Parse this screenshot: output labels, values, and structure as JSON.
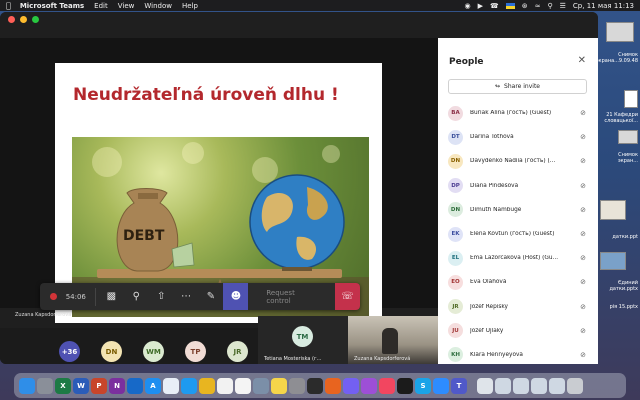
{
  "menubar": {
    "app_name": "Microsoft Teams",
    "menus": [
      "Edit",
      "View",
      "Window",
      "Help"
    ],
    "clock": "Ср, 11 мая  11:13"
  },
  "slide": {
    "title": "Neudržateľná úroveň dlhu !",
    "bag_label": "DEBT"
  },
  "toolbar": {
    "timer": "54:06",
    "request_control": "Request control"
  },
  "presenter_name": "Zuzana Kapsdorferová",
  "strip": {
    "overflow_count": "+36",
    "avatars": [
      {
        "initials": "DN",
        "color": "#f3e4b3",
        "text": "#7a5c00"
      },
      {
        "initials": "WM",
        "color": "#dbead0",
        "text": "#3f6b28"
      },
      {
        "initials": "TP",
        "color": "#f1dcd5",
        "text": "#7a3e2b"
      },
      {
        "initials": "JR",
        "color": "#dde7cf",
        "text": "#4b6a2a"
      }
    ],
    "tile_tm": {
      "initials": "TM",
      "name": "Tetiana Mosteriska (г..."
    },
    "tile_zk": {
      "name": "Zuzana Kapsdorferová"
    }
  },
  "people": {
    "title": "People",
    "share_label": "Share invite",
    "participants": [
      {
        "initials": "BA",
        "name": "Buriak Alina (гость) (Guest)",
        "color": "#f1dbe0",
        "text": "#8a2d45"
      },
      {
        "initials": "DT",
        "name": "Darina Tóthová",
        "color": "#dde3f5",
        "text": "#3a4f9a"
      },
      {
        "initials": "DN",
        "name": "Davydenko Nadiia (гость) (...",
        "color": "#f8e7bf",
        "text": "#8a6100"
      },
      {
        "initials": "DP",
        "name": "Diana Pindešová",
        "color": "#e2ddf3",
        "text": "#4b3c91"
      },
      {
        "initials": "DN",
        "name": "Dimuth Nambuge",
        "color": "#dcecdf",
        "text": "#2f6e3c"
      },
      {
        "initials": "EK",
        "name": "Elena Kovtun (гость) (Guest)",
        "color": "#dfe3f7",
        "text": "#3c4da0"
      },
      {
        "initials": "EL",
        "name": "Ema Lazorcakova (Host) (Gu...",
        "color": "#dbeff2",
        "text": "#1f6f7d"
      },
      {
        "initials": "EO",
        "name": "Eva Oláhová",
        "color": "#f7dede",
        "text": "#a23434"
      },
      {
        "initials": "JR",
        "name": "Jozef Repiský",
        "color": "#e5ecd6",
        "text": "#4f6a23"
      },
      {
        "initials": "JU",
        "name": "Jozef Ujlaky",
        "color": "#f5dede",
        "text": "#a33a3a"
      },
      {
        "initials": "KH",
        "name": "Klára Hennyeyová",
        "color": "#dcefe0",
        "text": "#2e6e3f"
      }
    ]
  },
  "desktop_files": [
    "Снимок\nэкрана...9.09.48",
    "21 Кафедри\nсловацької...",
    "Снимок\nэкран...",
    "датки.ppt",
    "Єдиний\nдатки.pptx",
    "рія 15.pptx"
  ],
  "dock": {
    "apps": [
      {
        "name": "finder-icon",
        "color": "#2f8ee8",
        "label": ""
      },
      {
        "name": "files-icon",
        "color": "#8a8f99",
        "label": ""
      },
      {
        "name": "excel-icon",
        "color": "#1d7a45",
        "label": "X"
      },
      {
        "name": "word-icon",
        "color": "#2b5cb8",
        "label": "W"
      },
      {
        "name": "powerpoint-icon",
        "color": "#c8452b",
        "label": "P"
      },
      {
        "name": "onenote-icon",
        "color": "#7b2f9e",
        "label": "N"
      },
      {
        "name": "outlook-icon",
        "color": "#1769c8",
        "label": ""
      },
      {
        "name": "appstore-icon",
        "color": "#1e8ef0",
        "label": "A"
      },
      {
        "name": "icloud-icon",
        "color": "#e8eef7",
        "label": ""
      },
      {
        "name": "safari-icon",
        "color": "#1e9af0",
        "label": ""
      },
      {
        "name": "chrome-icon",
        "color": "#e8b520",
        "label": ""
      },
      {
        "name": "photos-icon",
        "color": "#f2f2f2",
        "label": ""
      },
      {
        "name": "reminders-icon",
        "color": "#f4f4f4",
        "label": ""
      },
      {
        "name": "launchpad-icon",
        "color": "#7b8fa8",
        "label": ""
      },
      {
        "name": "notes-icon",
        "color": "#f5d54a",
        "label": ""
      },
      {
        "name": "settings-icon",
        "color": "#8e8e93",
        "label": ""
      },
      {
        "name": "clock-icon",
        "color": "#2b2b2b",
        "label": ""
      },
      {
        "name": "firefox-icon",
        "color": "#e8641f",
        "label": ""
      },
      {
        "name": "viber-icon",
        "color": "#7360f2",
        "label": ""
      },
      {
        "name": "podcasts-icon",
        "color": "#9d4fd6",
        "label": ""
      },
      {
        "name": "music-icon",
        "color": "#f24660",
        "label": ""
      },
      {
        "name": "tv-icon",
        "color": "#1b1b1b",
        "label": ""
      },
      {
        "name": "skype-icon",
        "color": "#1aa3e8",
        "label": "S"
      },
      {
        "name": "zoom-icon",
        "color": "#2d8cff",
        "label": ""
      },
      {
        "name": "teams-icon",
        "color": "#5059c9",
        "label": "T"
      },
      {
        "name": "preview-icon",
        "color": "#dfe4ea",
        "label": ""
      },
      {
        "name": "folder-icon",
        "color": "#cfd8e3",
        "label": ""
      },
      {
        "name": "folder-icon-2",
        "color": "#cfd8e3",
        "label": ""
      },
      {
        "name": "folder-icon-3",
        "color": "#cfd8e3",
        "label": ""
      },
      {
        "name": "folder-icon-4",
        "color": "#cfd8e3",
        "label": ""
      },
      {
        "name": "trash-icon",
        "color": "#c9ccd1",
        "label": ""
      }
    ]
  }
}
